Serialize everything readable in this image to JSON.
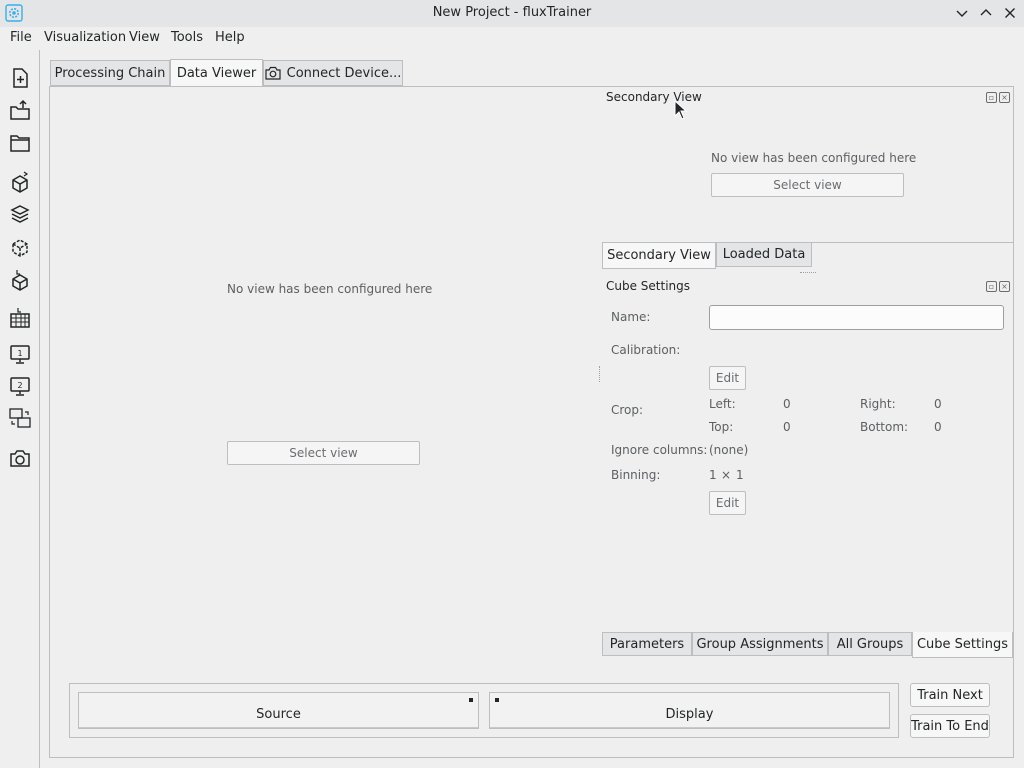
{
  "window": {
    "title": "New Project - fluxTrainer"
  },
  "menu": [
    "File",
    "Visualization",
    "View",
    "Tools",
    "Help"
  ],
  "toolbar_icons": [
    "new-file-icon",
    "export-icon",
    "open-folder-icon",
    "cube-export-icon",
    "layers-icon",
    "cube-sparkle-icon",
    "cube-import-icon",
    "table-import-icon",
    "monitor-1-icon",
    "monitor-2-icon",
    "monitor-swap-icon",
    "camera-icon"
  ],
  "tabs": {
    "processing_chain": "Processing Chain",
    "data_viewer": "Data Viewer",
    "connect_device": "Connect Device..."
  },
  "main_view": {
    "empty_text": "No view has been configured here",
    "select_view": "Select view"
  },
  "secondary_view": {
    "title": "Secondary View",
    "empty_text": "No view has been configured here",
    "select_view": "Select view"
  },
  "mid_tabs": {
    "secondary_view": "Secondary View",
    "loaded_data": "Loaded Data"
  },
  "cube_settings": {
    "title": "Cube Settings",
    "name_label": "Name:",
    "name_value": "",
    "calibration_label": "Calibration:",
    "edit_label": "Edit",
    "crop_label": "Crop:",
    "left_label": "Left:",
    "left_value": "0",
    "right_label": "Right:",
    "right_value": "0",
    "top_label": "Top:",
    "top_value": "0",
    "bottom_label": "Bottom:",
    "bottom_value": "0",
    "ignore_label": "Ignore columns:",
    "ignore_value": "(none)",
    "binning_label": "Binning:",
    "binning_x": "1",
    "binning_sep": "×",
    "binning_y": "1",
    "edit2_label": "Edit"
  },
  "bottom_tabs": {
    "parameters": "Parameters",
    "group_assignments": "Group Assignments",
    "all_groups": "All Groups",
    "cube_settings": "Cube Settings"
  },
  "footer": {
    "source": "Source",
    "display": "Display",
    "train_next": "Train Next",
    "train_to_end": "Train To End"
  },
  "colors": {
    "accent": "#3daee9",
    "window_bg": "#efefef",
    "border": "#bcbebf"
  }
}
